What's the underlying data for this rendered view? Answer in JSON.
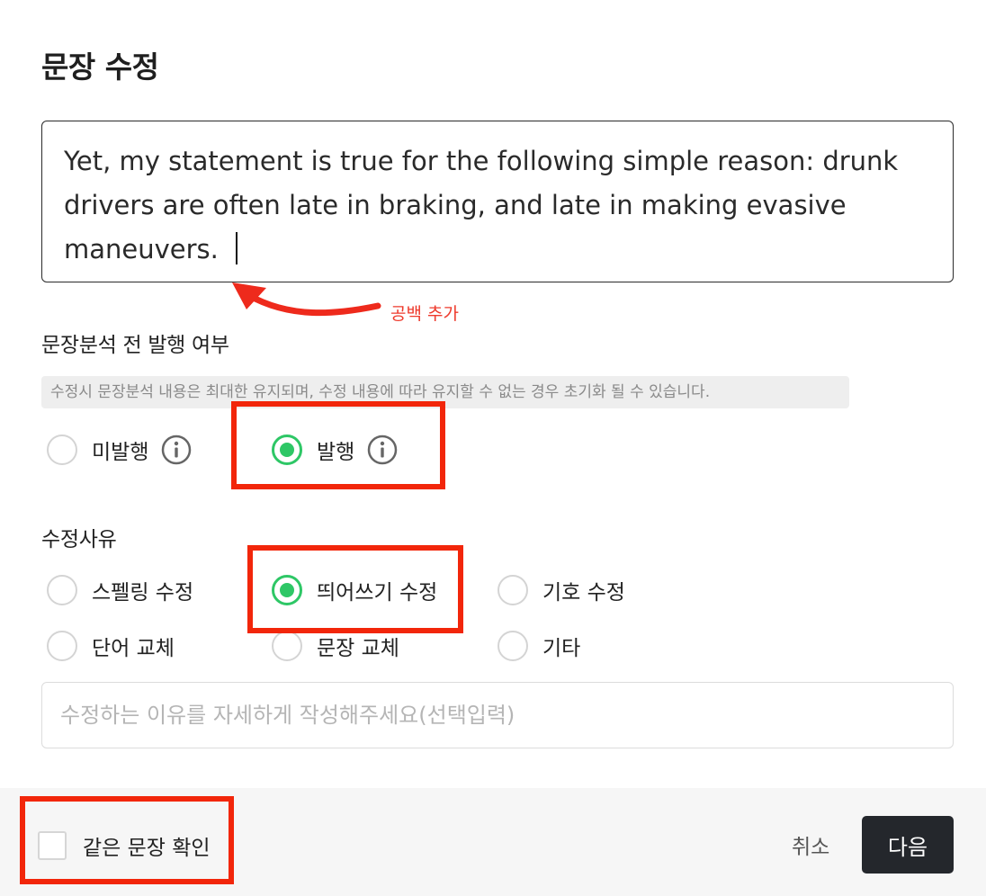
{
  "dialog": {
    "title": "문장 수정",
    "sentence_text": "Yet, my statement is true for the following simple reason: drunk drivers are often late in braking, and late in making evasive maneuvers. "
  },
  "annotation": {
    "label": "공백 추가",
    "color": "#ee3a2c"
  },
  "publish": {
    "label": "문장분석 전 발행 여부",
    "notice": "수정시 문장분석 내용은 최대한 유지되며, 수정 내용에 따라 유지할 수 없는 경우 초기화 될 수 있습니다.",
    "options": [
      {
        "label": "미발행",
        "checked": false,
        "icon": "info-icon"
      },
      {
        "label": "발행",
        "checked": true,
        "icon": "info-icon"
      }
    ]
  },
  "reason": {
    "label": "수정사유",
    "options": [
      {
        "label": "스펠링 수정",
        "checked": false
      },
      {
        "label": "띄어쓰기 수정",
        "checked": true
      },
      {
        "label": "기호 수정",
        "checked": false
      },
      {
        "label": "단어 교체",
        "checked": false
      },
      {
        "label": "문장 교체",
        "checked": false
      },
      {
        "label": "기타",
        "checked": false
      }
    ],
    "input_placeholder": "수정하는 이유를 자세하게 작성해주세요(선택입력)",
    "input_value": ""
  },
  "footer": {
    "same_sentence_label": "같은 문장 확인",
    "same_sentence_checked": false,
    "cancel_label": "취소",
    "next_label": "다음"
  },
  "colors": {
    "accent_green": "#2ec766",
    "highlight_red": "#f2260a",
    "primary_button": "#24272c"
  }
}
